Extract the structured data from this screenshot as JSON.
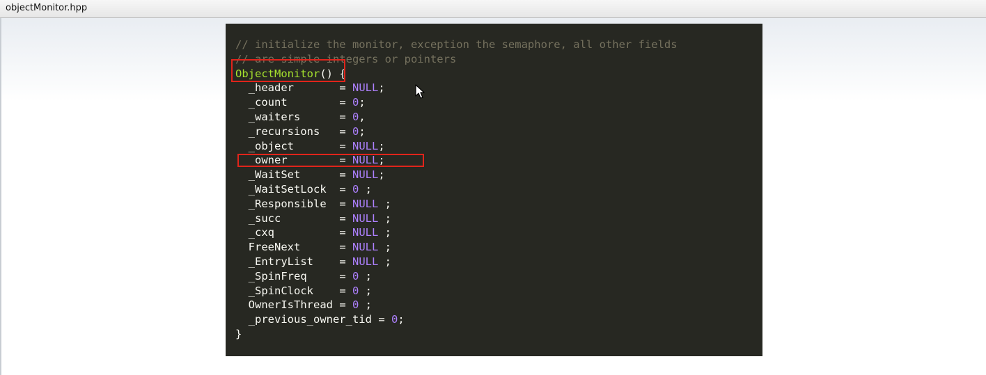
{
  "window": {
    "title": "objectMonitor.hpp"
  },
  "code": {
    "comment_1": "// initialize the monitor, exception the semaphore, all other fields",
    "comment_2": "// are simple integers or pointers",
    "constructor_name": "ObjectMonitor",
    "constructor_suffix": "() {",
    "closing_brace": "}",
    "fields": [
      {
        "name": "  _header       ",
        "op": "= ",
        "value": "NULL",
        "end": ";"
      },
      {
        "name": "  _count        ",
        "op": "= ",
        "value": "0",
        "end": ";"
      },
      {
        "name": "  _waiters      ",
        "op": "= ",
        "value": "0",
        "end": ","
      },
      {
        "name": "  _recursions   ",
        "op": "= ",
        "value": "0",
        "end": ";"
      },
      {
        "name": "  _object       ",
        "op": "= ",
        "value": "NULL",
        "end": ";"
      },
      {
        "name": "  _owner        ",
        "op": "= ",
        "value": "NULL",
        "end": ";"
      },
      {
        "name": "  _WaitSet      ",
        "op": "= ",
        "value": "NULL",
        "end": ";"
      },
      {
        "name": "  _WaitSetLock  ",
        "op": "= ",
        "value": "0",
        "end": " ;"
      },
      {
        "name": "  _Responsible  ",
        "op": "= ",
        "value": "NULL",
        "end": " ;"
      },
      {
        "name": "  _succ         ",
        "op": "= ",
        "value": "NULL",
        "end": " ;"
      },
      {
        "name": "  _cxq          ",
        "op": "= ",
        "value": "NULL",
        "end": " ;"
      },
      {
        "name": "  FreeNext      ",
        "op": "= ",
        "value": "NULL",
        "end": " ;"
      },
      {
        "name": "  _EntryList    ",
        "op": "= ",
        "value": "NULL",
        "end": " ;"
      },
      {
        "name": "  _SpinFreq     ",
        "op": "= ",
        "value": "0",
        "end": " ;"
      },
      {
        "name": "  _SpinClock    ",
        "op": "= ",
        "value": "0",
        "end": " ;"
      },
      {
        "name": "  OwnerIsThread ",
        "op": "= ",
        "value": "0",
        "end": " ;"
      },
      {
        "name": "  _previous_owner_tid ",
        "op": "= ",
        "value": "0",
        "end": ";"
      }
    ]
  },
  "colors": {
    "editor_background": "#272822",
    "comment": "#75715e",
    "function_name": "#a6e22e",
    "literal": "#ae81ff",
    "text": "#f8f8f2",
    "highlight_box": "#e0241b"
  }
}
